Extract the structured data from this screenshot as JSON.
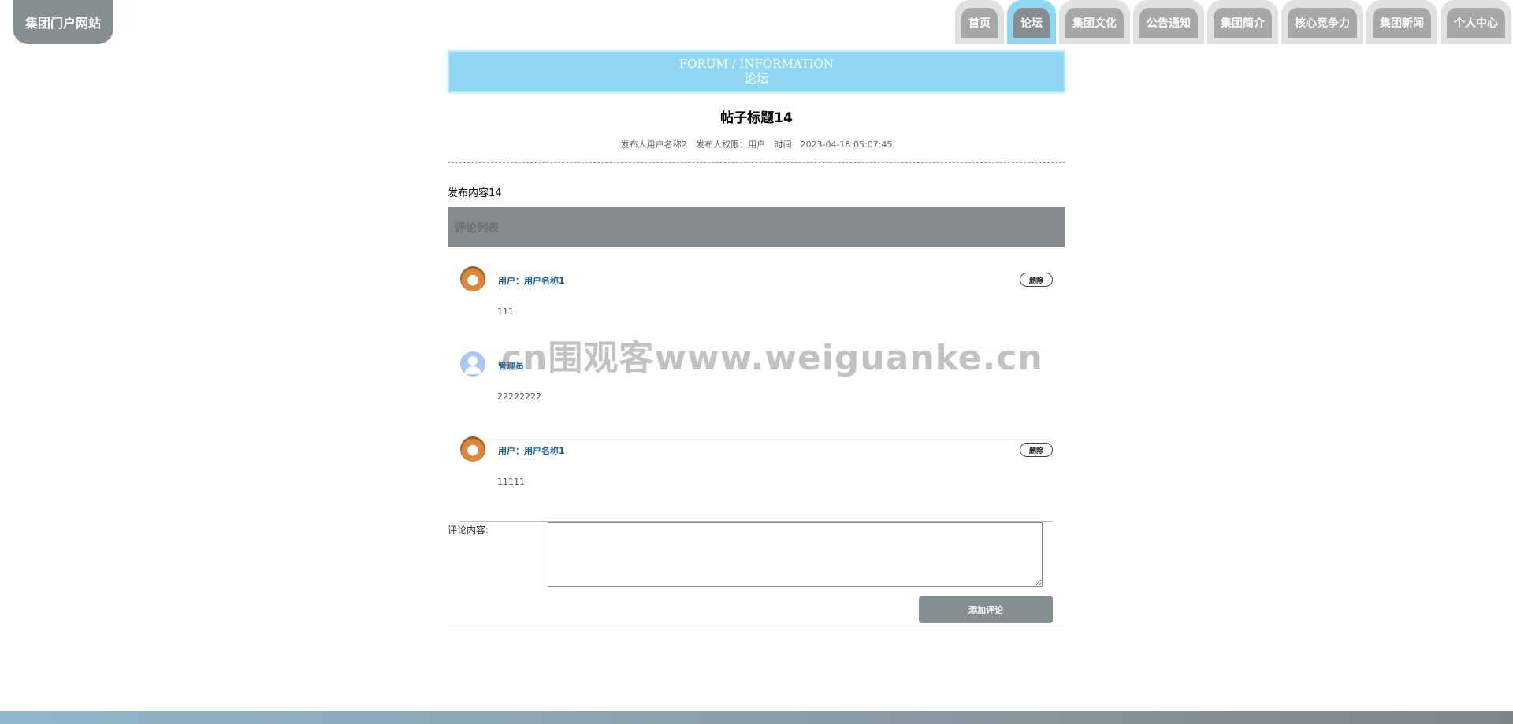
{
  "site": {
    "logo_text": "集团门户网站"
  },
  "nav": {
    "items": [
      {
        "label": "首页"
      },
      {
        "label": "论坛"
      },
      {
        "label": "集团文化"
      },
      {
        "label": "公告通知"
      },
      {
        "label": "集团简介"
      },
      {
        "label": "核心竞争力"
      },
      {
        "label": "集团新闻"
      },
      {
        "label": "个人中心"
      }
    ],
    "active_index": 1
  },
  "banner": {
    "en": "FORUM / INFORMATION",
    "cn": "论坛"
  },
  "post": {
    "title": "帖子标题14",
    "publisher": "发布人用户名称2",
    "role": "发布人权限：用户",
    "time": "时间：2023-04-18 05:07:45",
    "content": "发布内容14"
  },
  "comments_section": {
    "title": "评论列表"
  },
  "comments": [
    {
      "author": "用户：用户名称1",
      "body": "111",
      "avatar": "dog-avatar",
      "delete_label": "删除"
    },
    {
      "author": "管理员",
      "body": "22222222",
      "avatar": "default-user-avatar",
      "delete_label": ""
    },
    {
      "author": "用户：用户名称1",
      "body": "11111",
      "avatar": "dog-avatar",
      "delete_label": "删除"
    }
  ],
  "form": {
    "label": "评论内容:",
    "textarea_value": "",
    "submit_label": "添加评论"
  },
  "watermark": {
    "text": "cn围观客www.weiguanke.cn"
  },
  "colors": {
    "accent": "#8fd7f3",
    "nav_gray": "#878e92",
    "author_blue": "#1f5f8c"
  }
}
